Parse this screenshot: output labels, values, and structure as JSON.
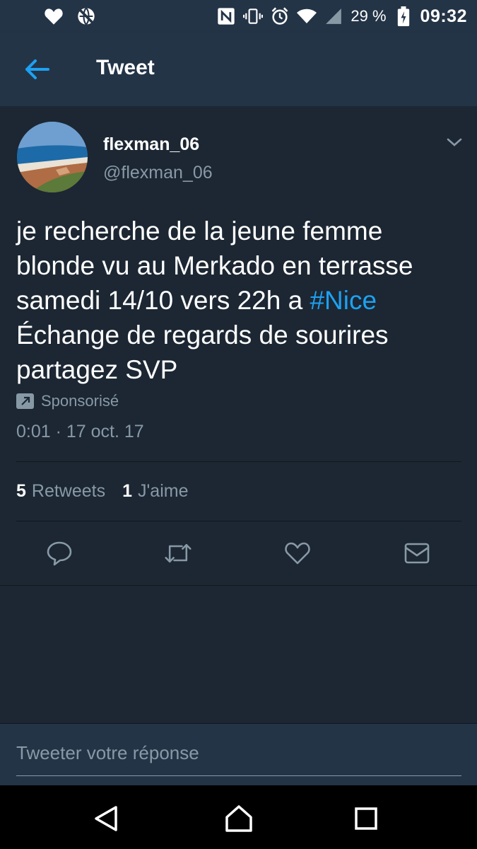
{
  "status_bar": {
    "battery_percent": "29 %",
    "time": "09:32",
    "icons": [
      "heart-icon",
      "no-sync-icon",
      "nfc-icon",
      "vibrate-icon",
      "alarm-icon",
      "wifi-icon",
      "signal-icon",
      "battery-charging-icon"
    ]
  },
  "appbar": {
    "title": "Tweet",
    "back_icon": "back-arrow-icon"
  },
  "tweet": {
    "display_name": "flexman_06",
    "handle": "@flexman_06",
    "text_lines": [
      "je recherche de la jeune femme",
      "blonde vu au Merkado en terrasse",
      "samedi 14/10 vers 22h a ",
      "Échange de regards de sourires",
      "partagez SVP"
    ],
    "hashtag": "#Nice",
    "promoted_label": "Sponsorisé",
    "timestamp": "0:01 · 17 oct. 17",
    "stats": {
      "retweets_count": "5",
      "retweets_label": "Retweets",
      "likes_count": "1",
      "likes_label": "J'aime"
    },
    "actions": [
      "reply-icon",
      "retweet-icon",
      "like-icon",
      "message-icon"
    ]
  },
  "reply": {
    "placeholder": "Tweeter votre réponse"
  },
  "colors": {
    "background": "#1c2733",
    "bar": "#243447",
    "accent": "#1da1f2",
    "secondary_text": "#8899a6"
  }
}
